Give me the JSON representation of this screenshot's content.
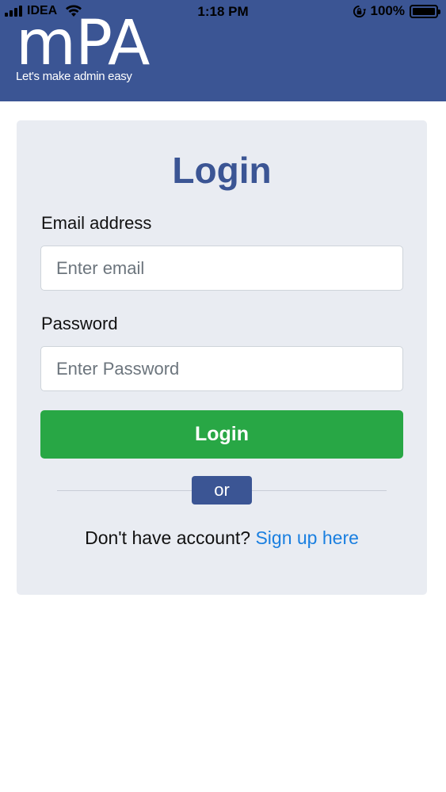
{
  "status_bar": {
    "carrier": "IDEA",
    "time": "1:18 PM",
    "battery": "100%",
    "battery_level": 1.0
  },
  "brand": {
    "logo": "mPA",
    "tagline": "Let's make admin easy"
  },
  "login_form": {
    "title": "Login",
    "email_label": "Email address",
    "email_placeholder": "Enter email",
    "email_value": "",
    "password_label": "Password",
    "password_placeholder": "Enter Password",
    "password_value": "",
    "submit_label": "Login",
    "divider_text": "or",
    "signup_prompt": "Don't have account?",
    "signup_link": "Sign up here"
  },
  "colors": {
    "brand": "#3b5594",
    "success": "#28a745",
    "link": "#1a7fe0",
    "card_bg": "#e9ecf2"
  },
  "icons": [
    "signal-icon",
    "wifi-icon",
    "rotation-lock-icon",
    "battery-icon"
  ]
}
